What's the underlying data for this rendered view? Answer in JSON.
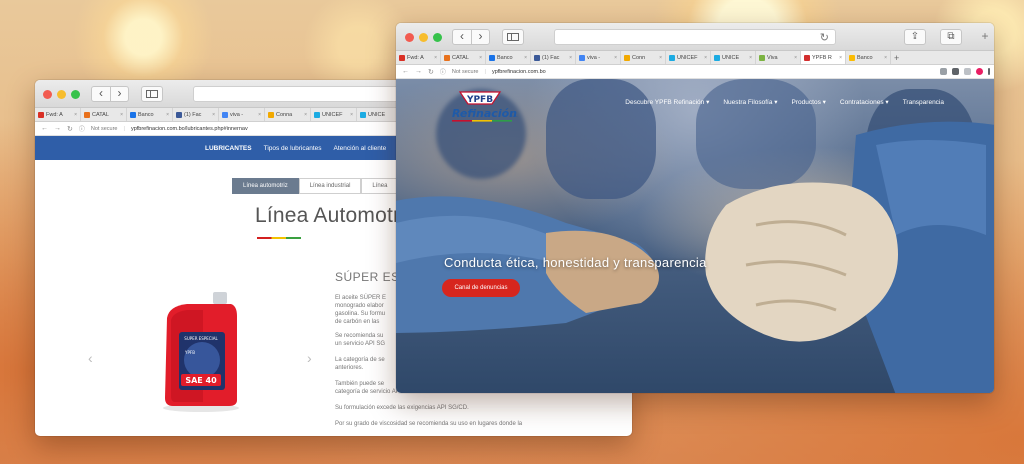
{
  "left_window": {
    "tabs": [
      {
        "label": "Fwd: A",
        "color": "#d93025"
      },
      {
        "label": "CATAL",
        "color": "#e8711c"
      },
      {
        "label": "Banco",
        "color": "#1a73e8"
      },
      {
        "label": "(1) Fac",
        "color": "#3b5998"
      },
      {
        "label": "viva -",
        "color": "#4285f4"
      },
      {
        "label": "Conna",
        "color": "#f2a900"
      },
      {
        "label": "UNICEF",
        "color": "#1cabe2"
      },
      {
        "label": "UNICE",
        "color": "#1cabe2"
      }
    ],
    "address": {
      "secure_label": "Not secure",
      "url": "ypfbrefinacion.com.bo/lubricantes.php#innernav"
    },
    "site_nav": [
      "LUBRICANTES",
      "Tipos de lubricantes",
      "Atención al cliente"
    ],
    "line_tabs": [
      "Línea automotriz",
      "Línea industrial",
      "Línea"
    ],
    "heading": "Línea Automotriz",
    "product_title": "SÚPER ES",
    "paragraphs": [
      "El aceite SÚPER E",
      "monogrado elabor",
      "gasolina. Su formu",
      "de carbón en las",
      "Se recomienda su",
      "un servicio API SG",
      "La categoría de se",
      "anteriores.",
      "También puede se",
      "categoría de servicio API CD o anteriores.",
      "Su formulación excede las exigencias API SG/CD.",
      "Por su grado de viscosidad se recomienda su uso en lugares donde la"
    ],
    "carousel": {
      "prev": "‹",
      "next": "›"
    },
    "bottle": {
      "label": "SAE 40",
      "brand": "SUPER ESPECIAL",
      "mark": "YPFB",
      "color": "#e21d2a"
    }
  },
  "right_window": {
    "tabs": [
      {
        "label": "Fwd: A",
        "color": "#d93025"
      },
      {
        "label": "CATAL",
        "color": "#e8711c"
      },
      {
        "label": "Banco",
        "color": "#1a73e8"
      },
      {
        "label": "(1) Fac",
        "color": "#3b5998"
      },
      {
        "label": "viva - ",
        "color": "#4285f4"
      },
      {
        "label": "Conn",
        "color": "#f2a900"
      },
      {
        "label": "UNICEF",
        "color": "#1cabe2"
      },
      {
        "label": "UNICE",
        "color": "#1cabe2"
      },
      {
        "label": "Viva",
        "color": "#7cb342"
      },
      {
        "label": "YPFB R",
        "color": "#d32f2f"
      },
      {
        "label": "Banco",
        "color": "#fbbc04"
      }
    ],
    "active_tab_index": 9,
    "new_tab": "+",
    "address": {
      "secure_label": "Not secure",
      "url": "ypfbrefinacion.com.bo"
    },
    "logo": {
      "mark": "YPFB",
      "text": "Refinación",
      "suffix": "S.A."
    },
    "nav": [
      "Descubre YPFB Refinación ▾",
      "Nuestra Filosofía ▾",
      "Productos ▾",
      "Contrataciones ▾",
      "Transparencia"
    ],
    "tagline": "Conducta ética, honestidad y transparencia",
    "cta": "Canal de denuncias"
  },
  "colors": {
    "brand_blue": "#2f5ea8",
    "cta_red": "#d7261e",
    "active_tab": "#6b7b8f"
  }
}
